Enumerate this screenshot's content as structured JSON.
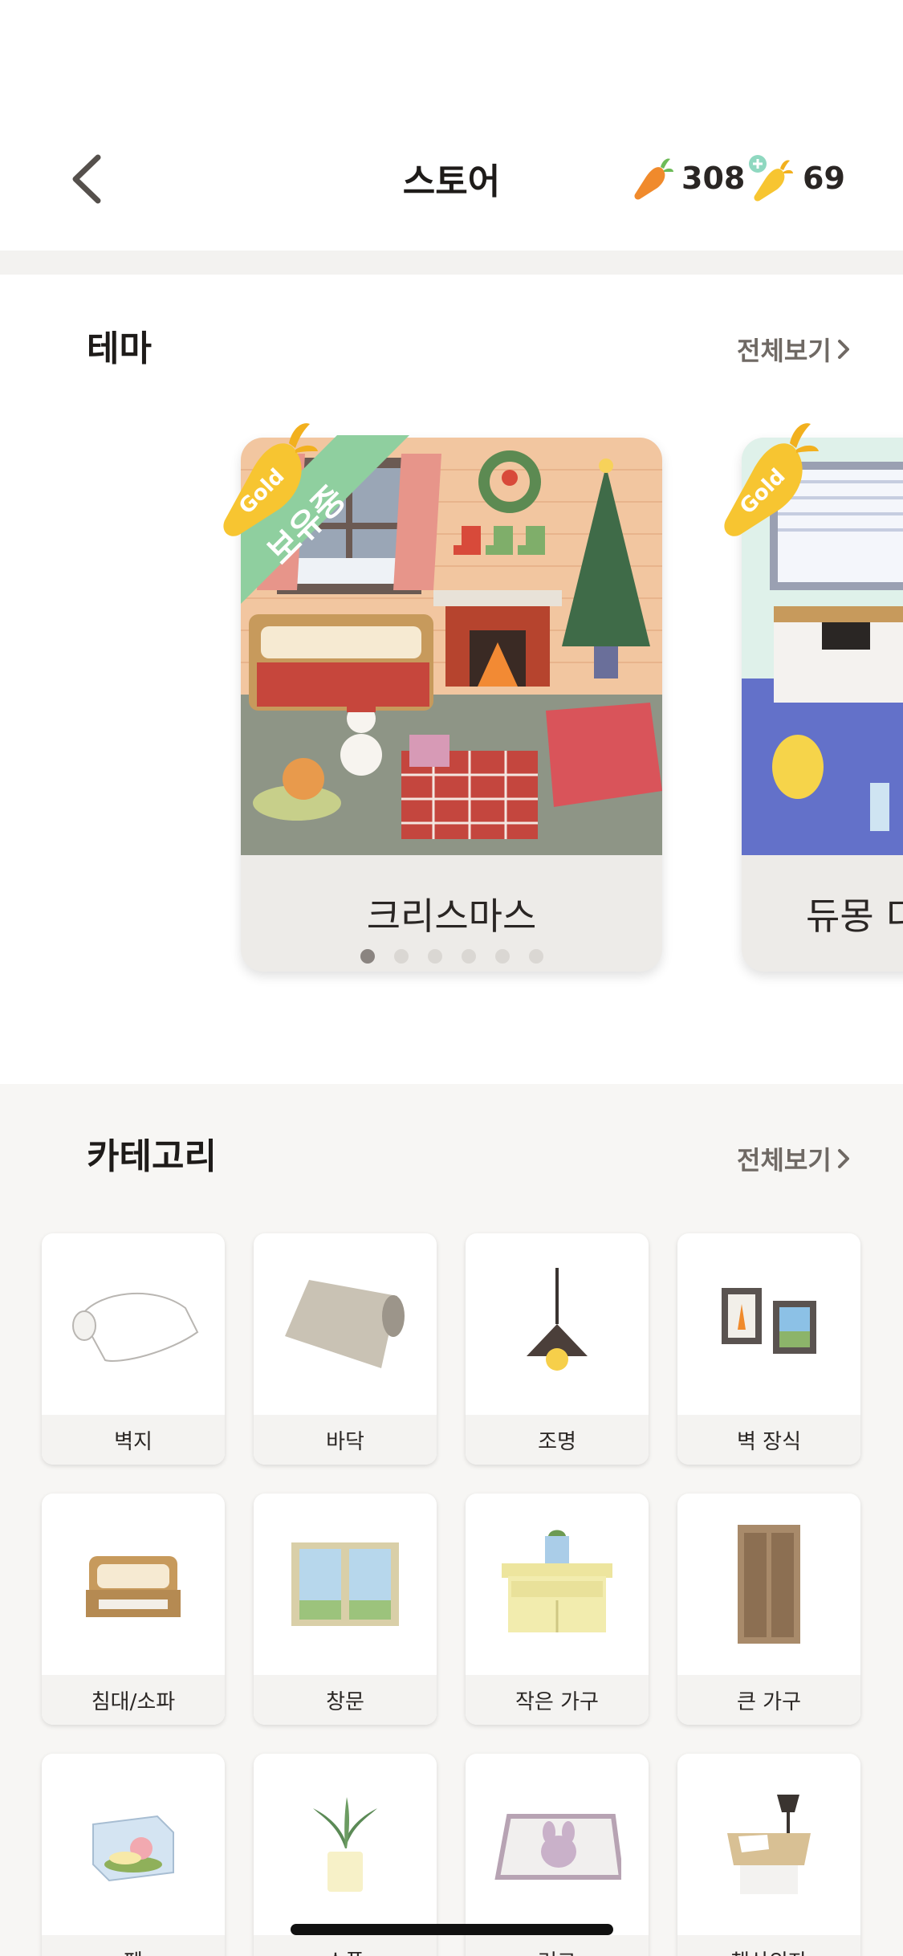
{
  "header": {
    "title": "스토어",
    "carrot_count": "308",
    "gold_carrot_count": "69"
  },
  "theme": {
    "title": "테마",
    "see_all": "전체보기",
    "cards": [
      {
        "name": "크리스마스",
        "badge": "Gold",
        "owned_ribbon": "보유중"
      },
      {
        "name": "듀몽 디",
        "badge": "Gold"
      }
    ],
    "page_count": 6,
    "active_page": 1
  },
  "category": {
    "title": "카테고리",
    "see_all": "전체보기",
    "items": [
      {
        "label": "벽지",
        "icon": "wallpaper-roll-icon"
      },
      {
        "label": "바닥",
        "icon": "floor-roll-icon"
      },
      {
        "label": "조명",
        "icon": "pendant-lamp-icon"
      },
      {
        "label": "벽 장식",
        "icon": "wall-frames-icon"
      },
      {
        "label": "침대/소파",
        "icon": "bed-icon"
      },
      {
        "label": "창문",
        "icon": "window-icon"
      },
      {
        "label": "작은 가구",
        "icon": "cabinet-icon"
      },
      {
        "label": "큰 가구",
        "icon": "wardrobe-icon"
      },
      {
        "label": "펫",
        "icon": "snail-tank-icon"
      },
      {
        "label": "소품",
        "icon": "plant-pot-icon"
      },
      {
        "label": "러그",
        "icon": "rug-icon"
      },
      {
        "label": "책상의자",
        "icon": "desk-icon"
      }
    ]
  },
  "colors": {
    "carrot": "#f08a2c",
    "gold": "#f7c531",
    "ribbon": "#8fcf9f",
    "dot_active": "#8a8480"
  }
}
